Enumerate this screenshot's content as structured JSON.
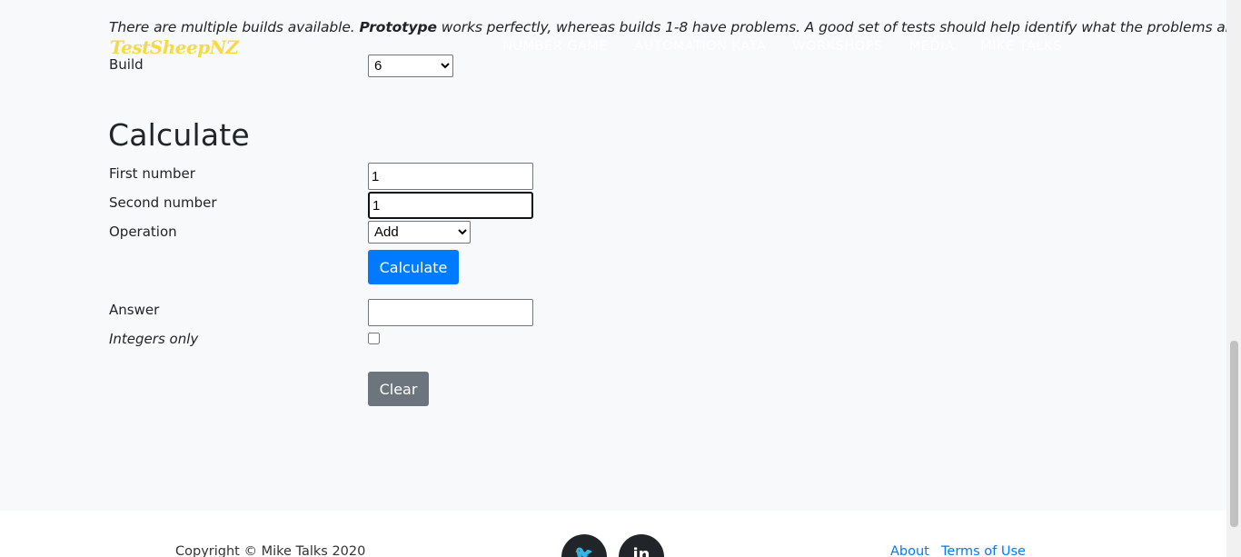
{
  "intro": {
    "text_before": "There are multiple builds available. ",
    "bold": "Prototype",
    "text_after": " works perfectly, whereas builds 1-8 have problems. A good set of tests should help identify what the problems are."
  },
  "header": {
    "brand": "TestSheepNZ",
    "nav": [
      "NUMBER GAME",
      "AUTOMATION KATA",
      "WORKSHOPS",
      "MEDIA",
      "MIKE TALKS"
    ]
  },
  "build": {
    "label": "Build",
    "selected": "6"
  },
  "calculate": {
    "heading": "Calculate",
    "first_label": "First number",
    "first_value": "1",
    "second_label": "Second number",
    "second_value": "1",
    "operation_label": "Operation",
    "operation_selected": "Add",
    "calculate_button": "Calculate",
    "answer_label": "Answer",
    "answer_value": "",
    "integers_label": "Integers only",
    "integers_checked": false,
    "clear_button": "Clear"
  },
  "footer": {
    "copyright": "Copyright © Mike Talks 2020",
    "twitter_glyph": "🐦",
    "linkedin_glyph": "in",
    "about": "About",
    "terms": "Terms of Use"
  },
  "colors": {
    "brand": "#f5d94a",
    "primary": "#007bff",
    "secondary": "#6c757d",
    "background": "#f8f9fa"
  }
}
